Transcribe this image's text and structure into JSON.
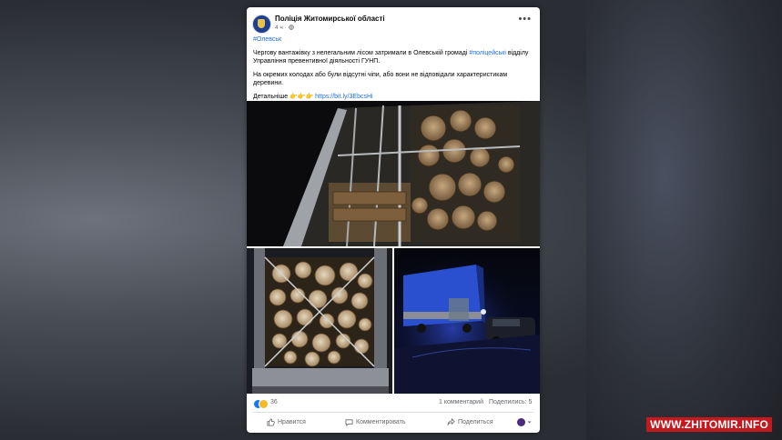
{
  "post": {
    "page_name": "Поліція Житомирської області",
    "time": "4 ч",
    "hashtag": "#Олевськ",
    "paragraph1_part1": "Чергову вантажівку з нелегальним лісом затримали в Олевській громаді ",
    "paragraph1_tag": "#поліцейські",
    "paragraph1_part2": " відділу Управління превентивної діяльності ГУНП.",
    "paragraph2": "На окремих колодах або були відсутні чіпи, або вони не відповідали характеристикам деревини.",
    "details_label": "Детальніше",
    "details_emojis": "👉👉👉",
    "link": "https://bit.ly/3EbcsHi"
  },
  "stats": {
    "reactions_count": "36",
    "comments": "1 комментарий",
    "shares": "Поделились: 5"
  },
  "actions": {
    "like": "Нравится",
    "comment": "Комментировать",
    "share": "Поделиться"
  },
  "icons": {
    "like": "thumbs-up-icon",
    "comment": "speech-bubble-icon",
    "share": "share-arrow-icon",
    "more": "more-options-icon",
    "dropdown": "chevron-down-icon"
  },
  "watermark": "WWW.ZHITOMIR.INFO",
  "colors": {
    "link": "#216fdb",
    "like_blue": "#1877f2",
    "haha_yellow": "#f7b928",
    "watermark_red": "#c4191e"
  }
}
